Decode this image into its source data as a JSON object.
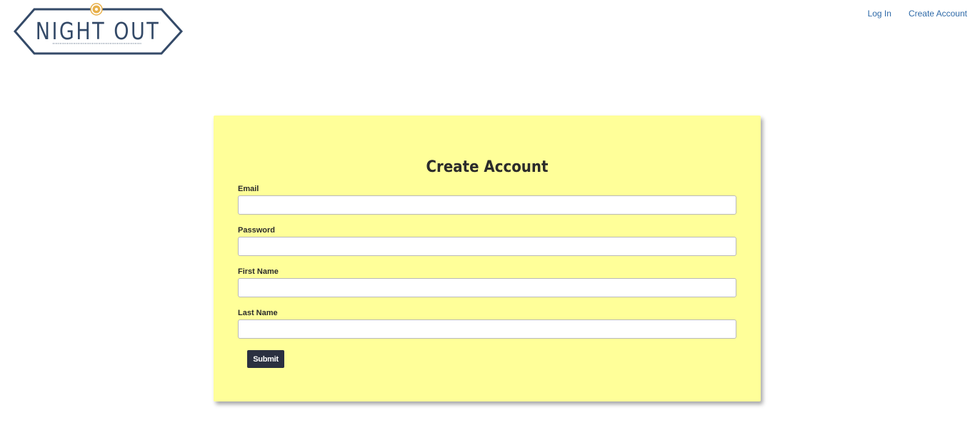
{
  "header": {
    "logo_text": "NIGHT OUT",
    "nav": {
      "login_label": "Log In",
      "create_account_label": "Create Account"
    }
  },
  "form": {
    "title": "Create Account",
    "fields": [
      {
        "label": "Email",
        "value": "",
        "placeholder": ""
      },
      {
        "label": "Password",
        "value": "",
        "placeholder": ""
      },
      {
        "label": "First Name",
        "value": "",
        "placeholder": ""
      },
      {
        "label": "Last Name",
        "value": "",
        "placeholder": ""
      }
    ],
    "submit_label": "Submit"
  },
  "colors": {
    "card_background": "#ffff99",
    "logo_navy": "#344a68",
    "logo_accent": "#e8b04a",
    "link": "#2f6aa8",
    "button": "#2b3040"
  },
  "icons": {
    "logo_emblem": "sun-icon"
  }
}
